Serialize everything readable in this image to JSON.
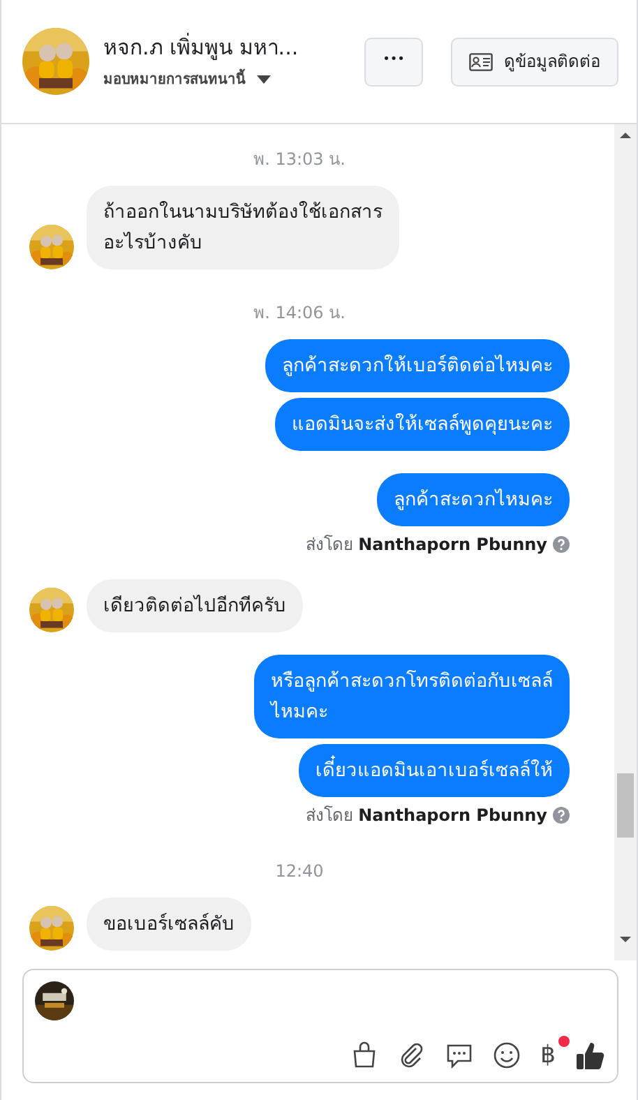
{
  "header": {
    "title": "หจก.ภ เพิ่มพูน มหา...",
    "assign_label": "มอบหมายการสนทนานี้",
    "more_button": "•••",
    "contact_button": "ดูข้อมูลติดต่อ"
  },
  "messages": [
    {
      "kind": "time",
      "text": "พ. 13:03 น."
    },
    {
      "kind": "incoming",
      "texts": [
        "ถ้าออกในนามบริษัทต้องใช้เอกสาร\nอะไรบ้างคับ"
      ]
    },
    {
      "kind": "time",
      "text": "พ. 14:06 น."
    },
    {
      "kind": "outgoing",
      "texts": [
        "ลูกค้าสะดวกให้เบอร์ติดต่อไหมคะ",
        "แอดมินจะส่งให้เซลล์พูดคุยนะคะ"
      ]
    },
    {
      "kind": "outgoing",
      "texts": [
        "ลูกค้าสะดวกไหมคะ"
      ]
    },
    {
      "kind": "sent_by",
      "prefix": "ส่งโดย",
      "name": "Nanthaporn Pbunny"
    },
    {
      "kind": "incoming",
      "texts": [
        "เดียวติดต่อไปอีกทีครับ"
      ]
    },
    {
      "kind": "outgoing",
      "texts": [
        "หรือลูกค้าสะดวกโทรติดต่อกับเซลล์\nไหมคะ",
        "เดี๋ยวแอดมินเอาเบอร์เซลล์ให้"
      ]
    },
    {
      "kind": "sent_by",
      "prefix": "ส่งโดย",
      "name": "Nanthaporn Pbunny"
    },
    {
      "kind": "time",
      "text": "12:40"
    },
    {
      "kind": "incoming",
      "texts": [
        "ขอเบอร์เซลล์คับ"
      ]
    }
  ],
  "composer": {
    "payment_symbol": "฿",
    "payment_notification": true
  }
}
